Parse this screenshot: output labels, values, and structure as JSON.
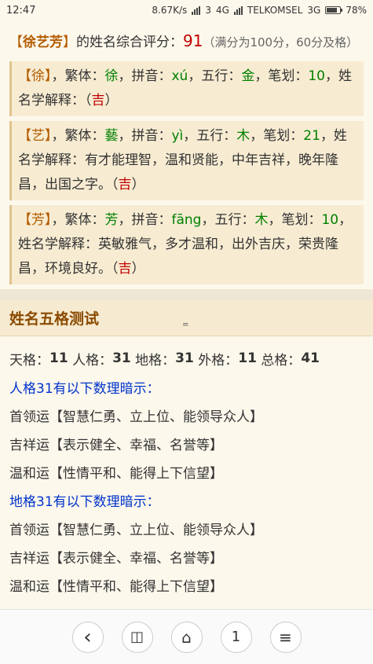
{
  "statusbar": {
    "time": "12:47",
    "speed": "8.67K/s",
    "net1": "3",
    "net1_type": "4G",
    "carrier": "TELKOMSEL",
    "carrier_type": "3G",
    "battery": "78%",
    "battery_level": 0.78
  },
  "summary": {
    "lb": "【",
    "name": "徐艺芳",
    "rb": "】",
    "text1": "的姓名综合评分：",
    "score": "91",
    "note": "（满分为100分，60分及格）"
  },
  "chars": [
    {
      "char": "徐",
      "trad_label": "，繁体：",
      "trad": "徐",
      "pinyin_label": "，拼音：",
      "pinyin": "xú",
      "wuxing_label": "，五行：",
      "wuxing": "金",
      "stroke_label": "，笔划：",
      "stroke": "10",
      "explain_label": "，姓名学解释：",
      "explain": "",
      "luck": "吉"
    },
    {
      "char": "艺",
      "trad_label": "，繁体：",
      "trad": "藝",
      "pinyin_label": "，拼音：",
      "pinyin": "yì",
      "wuxing_label": "，五行：",
      "wuxing": "木",
      "stroke_label": "，笔划：",
      "stroke": "21",
      "explain_label": "，姓名学解释：",
      "explain": "有才能理智，温和贤能，中年吉祥，晚年隆昌，出国之字。",
      "luck": "吉"
    },
    {
      "char": "芳",
      "trad_label": "，繁体：",
      "trad": "芳",
      "pinyin_label": "，拼音：",
      "pinyin": "fāng",
      "wuxing_label": "，五行：",
      "wuxing": "木",
      "stroke_label": "，笔划：",
      "stroke": "10",
      "explain_label": "，姓名学解释：",
      "explain": "英敏雅气，多才温和，出外吉庆，荣贵隆昌，环境良好。",
      "luck": "吉"
    }
  ],
  "wuge": {
    "title": "姓名五格测试",
    "head_glyph": "=",
    "tian_label": "天格：",
    "tian": "11",
    "ren_label": "人格：",
    "ren": "31",
    "di_label": "地格：",
    "di": "31",
    "wai_label": "外格：",
    "wai": "11",
    "zong_label": "总格：",
    "zong": "41",
    "ren_heading": "人格31有以下数理暗示：",
    "ren_items": [
      "首领运【智慧仁勇、立上位、能领导众人】",
      "吉祥运【表示健全、幸福、名誉等】",
      "温和运【性情平和、能得上下信望】"
    ],
    "di_heading": "地格31有以下数理暗示：",
    "di_items": [
      "首领运【智慧仁勇、立上位、能领导众人】",
      "吉祥运【表示健全、幸福、名誉等】",
      "温和运【性情平和、能得上下信望】"
    ]
  },
  "bottomnav": {
    "back": "‹",
    "book": "◫",
    "home": "⌂",
    "tabs": "1",
    "menu": "≡"
  }
}
